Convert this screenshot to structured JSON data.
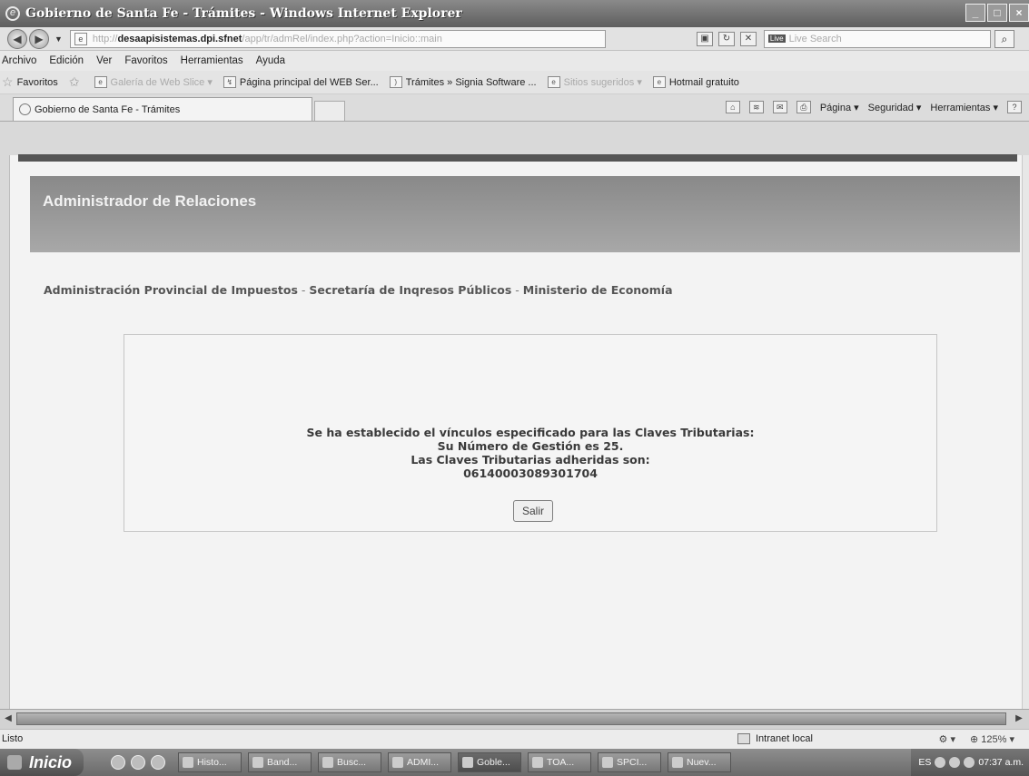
{
  "window": {
    "title": "Gobierno de Santa Fe - Trámites - Windows Internet Explorer",
    "buttons": [
      "_",
      "□",
      "×"
    ]
  },
  "address": {
    "url_prefix": "http://",
    "url_host": "desaapisistemas.dpi.sfnet",
    "url_path": "/app/tr/admRel/index.php?action=Inicio::main",
    "search_brand": "Live",
    "search_placeholder": "Live Search"
  },
  "menu": [
    "Archivo",
    "Edición",
    "Ver",
    "Favoritos",
    "Herramientas",
    "Ayuda"
  ],
  "favorites": {
    "label": "Favoritos",
    "items": [
      {
        "label": "Galería de Web Slice ▾",
        "dim": true
      },
      {
        "label": "Página principal del WEB Ser...",
        "dim": false
      },
      {
        "label": "Trámites » Signia Software ...",
        "dim": false
      },
      {
        "label": "Sitios sugeridos ▾",
        "dim": true
      },
      {
        "label": "Hotmail gratuito",
        "dim": false
      }
    ]
  },
  "tab": {
    "label": "Gobierno de Santa Fe - Trámites"
  },
  "commandbar": {
    "pagina": "Página ▾",
    "seguridad": "Seguridad ▾",
    "herramientas": "Herramientas ▾"
  },
  "page": {
    "banner_title": "Administrador de Relaciones",
    "subtitle_parts": [
      "Administración Provincial de Impuestos",
      "Secretaría de Inqresos Públicos",
      "Ministerio de Economía"
    ],
    "separator": " - ",
    "message_lines": [
      "Se ha establecido el vínculos especificado para las Claves Tributarias:",
      "Su Número de Gestión es 25.",
      "Las Claves Tributarias adheridas son:",
      "06140003089301704"
    ],
    "exit_button": "Salir"
  },
  "statusbar": {
    "status": "Listo",
    "zone": "Intranet local",
    "zoom": "125%"
  },
  "taskbar": {
    "start": "Inicio",
    "tasks": [
      "Histo...",
      "Band...",
      "Busc...",
      "ADMI...",
      "Goble...",
      "TOA...",
      "SPCI...",
      "Nuev..."
    ],
    "active_task_index": 4,
    "lang": "ES",
    "clock": "07:37 a.m."
  }
}
